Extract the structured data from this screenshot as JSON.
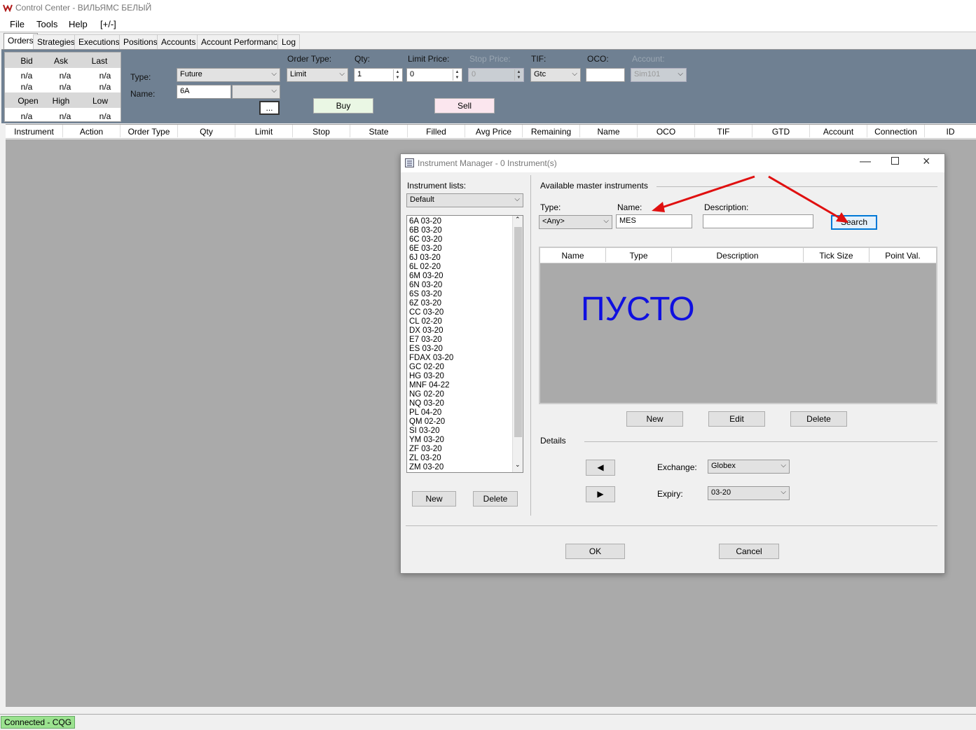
{
  "window": {
    "title": "Control Center - ВИЛЬЯМС БЕЛЫЙ"
  },
  "menu": [
    "File",
    "Tools",
    "Help",
    "[+/-]"
  ],
  "tabs": [
    "Orders",
    "Strategies",
    "Executions",
    "Positions",
    "Accounts",
    "Account Performance",
    "Log"
  ],
  "quote": {
    "row1_headers": [
      "Bid",
      "Ask",
      "Last"
    ],
    "row1_values": [
      "n/a",
      "n/a",
      "n/a"
    ],
    "row2_values": [
      "n/a",
      "n/a",
      "n/a"
    ],
    "row2_headers": [
      "Open",
      "High",
      "Low"
    ],
    "row3_values": [
      "n/a",
      "n/a",
      "n/a"
    ]
  },
  "order_entry": {
    "type_label": "Type:",
    "type_value": "Future",
    "name_label": "Name:",
    "name_value": "6A",
    "browse_label": "...",
    "order_type_label": "Order Type:",
    "order_type_value": "Limit",
    "qty_label": "Qty:",
    "qty_value": "1",
    "limit_label": "Limit Price:",
    "limit_value": "0",
    "stop_label": "Stop Price:",
    "stop_value": "0",
    "tif_label": "TIF:",
    "tif_value": "Gtc",
    "oco_label": "OCO:",
    "oco_value": "",
    "account_label": "Account:",
    "account_value": "Sim101",
    "buy_label": "Buy",
    "sell_label": "Sell",
    "buy_color": "#eaf7e4",
    "sell_color": "#fbe6ee"
  },
  "grid_columns": [
    "Instrument",
    "Action",
    "Order Type",
    "Qty",
    "Limit",
    "Stop",
    "State",
    "Filled",
    "Avg Price",
    "Remaining",
    "Name",
    "OCO",
    "TIF",
    "GTD",
    "Account",
    "Connection",
    "ID"
  ],
  "status": {
    "connection": "Connected - CQG",
    "connection_color": "#9be28f"
  },
  "dialog": {
    "title": "Instrument Manager - 0 Instrument(s)",
    "lists_label": "Instrument lists:",
    "list_selected": "Default",
    "instruments": [
      "6A 03-20",
      "6B 03-20",
      "6C 03-20",
      "6E 03-20",
      "6J 03-20",
      "6L 02-20",
      "6M 03-20",
      "6N 03-20",
      "6S 03-20",
      "6Z 03-20",
      "CC 03-20",
      "CL 02-20",
      "DX 03-20",
      "E7 03-20",
      "ES 03-20",
      "FDAX 03-20",
      "GC 02-20",
      "HG 03-20",
      "MNF 04-22",
      "NG 02-20",
      "NQ 03-20",
      "PL 04-20",
      "QM 02-20",
      "SI 03-20",
      "YM 03-20",
      "ZF 03-20",
      "ZL 03-20",
      "ZM 03-20"
    ],
    "list_new": "New",
    "list_delete": "Delete",
    "master_label": "Available master instruments",
    "type_label": "Type:",
    "type_value": "<Any>",
    "name_label": "Name:",
    "name_value": "MES",
    "desc_label": "Description:",
    "desc_value": "",
    "search_label": "Search",
    "result_columns": [
      "Name",
      "Type",
      "Description",
      "Tick Size",
      "Point Val."
    ],
    "empty_text": "ПУСТО",
    "empty_color": "#1010e0",
    "new_label": "New",
    "edit_label": "Edit",
    "delete_label": "Delete",
    "details_label": "Details",
    "exchange_label": "Exchange:",
    "exchange_value": "Globex",
    "expiry_label": "Expiry:",
    "expiry_value": "03-20",
    "ok_label": "OK",
    "cancel_label": "Cancel"
  },
  "annotation_color": "#e01010"
}
